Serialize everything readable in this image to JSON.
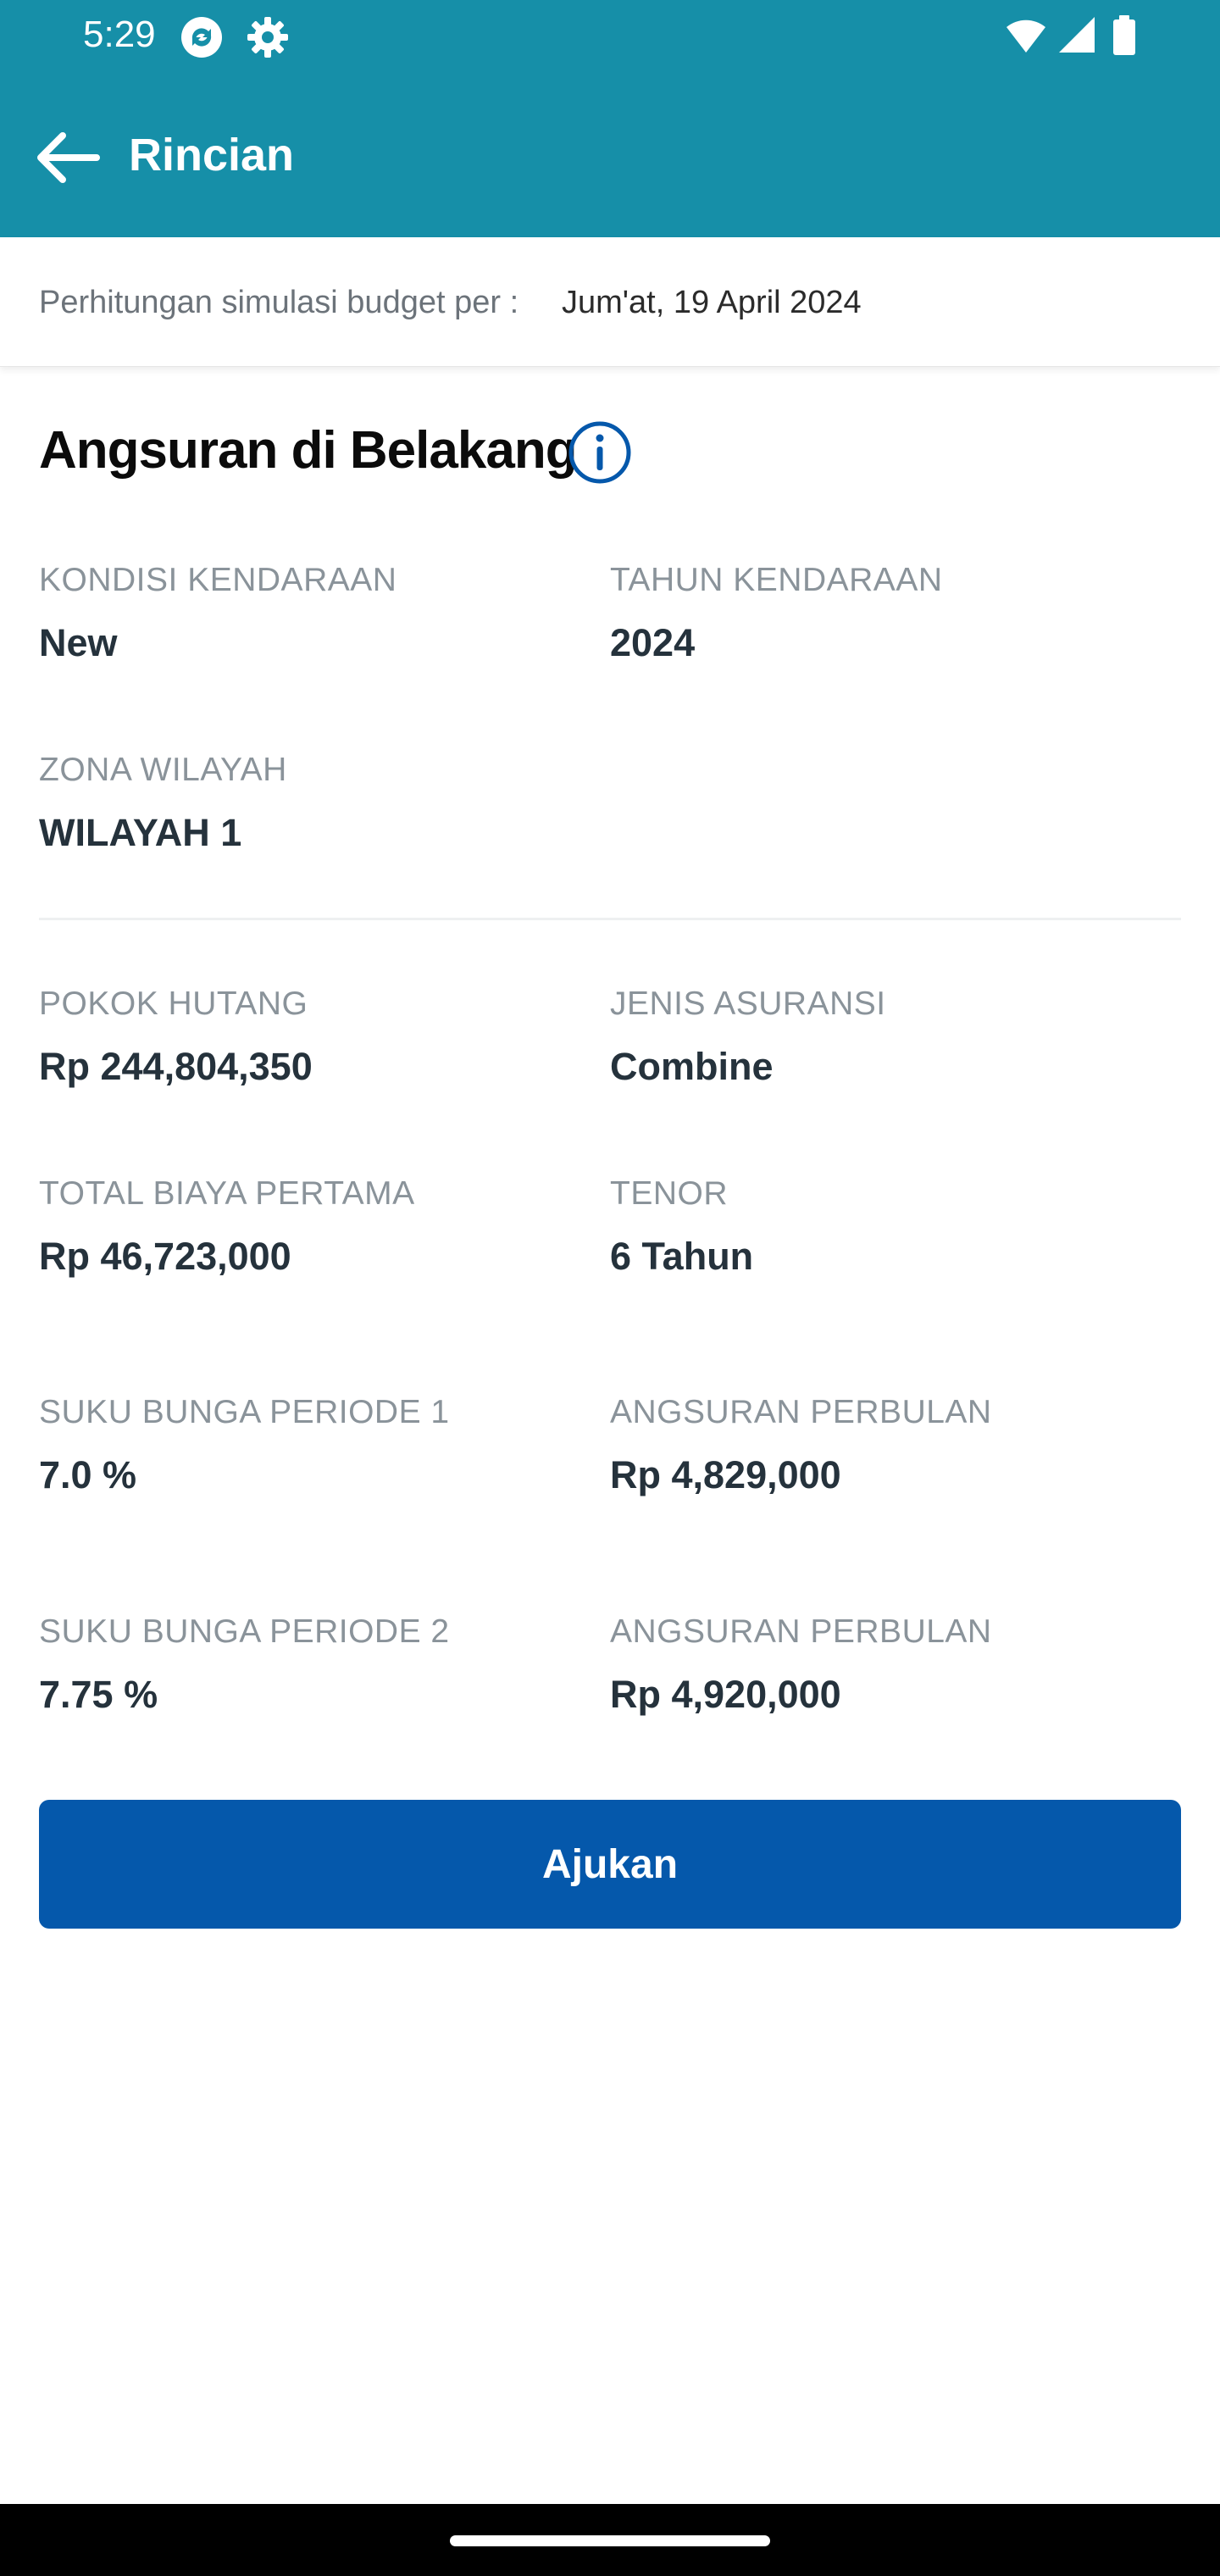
{
  "status_bar": {
    "time": "5:29",
    "icons": [
      "sync-icon",
      "settings-icon",
      "wifi-icon",
      "signal-icon",
      "battery-icon"
    ]
  },
  "app_bar": {
    "title": "Rincian",
    "back_icon": "arrow-left-icon",
    "background_color": "#168fa8"
  },
  "date_strip": {
    "label": "Perhitungan simulasi budget per :",
    "value": "Jum'at, 19 April 2024"
  },
  "section": {
    "title": "Angsuran di Belakang",
    "info_icon": "info-icon"
  },
  "fields": {
    "kondisi_kendaraan": {
      "label": "KONDISI KENDARAAN",
      "value": "New"
    },
    "tahun_kendaraan": {
      "label": "TAHUN KENDARAAN",
      "value": "2024"
    },
    "zona_wilayah": {
      "label": "ZONA WILAYAH",
      "value": "WILAYAH 1"
    },
    "pokok_hutang": {
      "label": "POKOK HUTANG",
      "value": "Rp 244,804,350"
    },
    "jenis_asuransi": {
      "label": "JENIS ASURANSI",
      "value": "Combine"
    },
    "total_biaya_pertama": {
      "label": "TOTAL BIAYA PERTAMA",
      "value": "Rp 46,723,000"
    },
    "tenor": {
      "label": "TENOR",
      "value": "6 Tahun"
    },
    "suku_bunga_periode_1": {
      "label": "SUKU BUNGA PERIODE 1",
      "value": "7.0 %"
    },
    "angsuran_perbulan_1": {
      "label": "ANGSURAN PERBULAN",
      "value": "Rp 4,829,000"
    },
    "suku_bunga_periode_2": {
      "label": "SUKU BUNGA PERIODE 2",
      "value": "7.75 %"
    },
    "angsuran_perbulan_2": {
      "label": "ANGSURAN PERBULAN",
      "value": "Rp 4,920,000"
    }
  },
  "actions": {
    "submit_label": "Ajukan",
    "submit_color": "#0558ab"
  }
}
